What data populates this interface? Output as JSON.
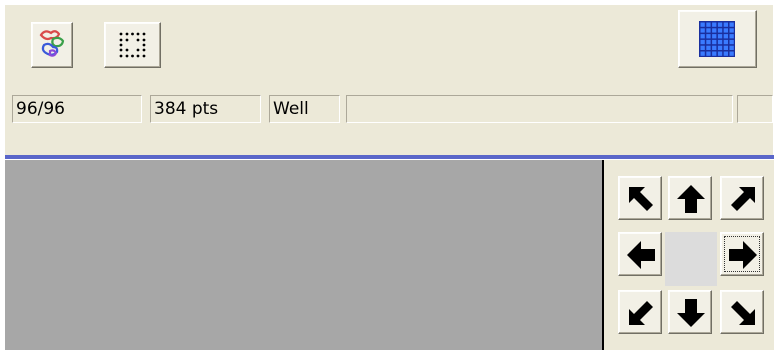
{
  "toolbar": {
    "colorize_icon": "colored-molecule-icon",
    "grid_points_icon": "point-grid-icon",
    "well_grid_icon": "blue-well-grid-icon",
    "accent_color": "#1f4fd6"
  },
  "status_bar": {
    "count": "96/96",
    "points": "384 pts",
    "mode": "Well",
    "message": "",
    "extra": ""
  },
  "separator_color": "#5a66c9",
  "canvas_background": "#a7a7a7",
  "nav_pad": {
    "buttons": [
      "arrow-up-left-icon",
      "arrow-up-icon",
      "arrow-up-right-icon",
      "arrow-left-icon",
      "arrow-right-icon",
      "arrow-down-left-icon",
      "arrow-down-icon",
      "arrow-down-right-icon"
    ]
  }
}
